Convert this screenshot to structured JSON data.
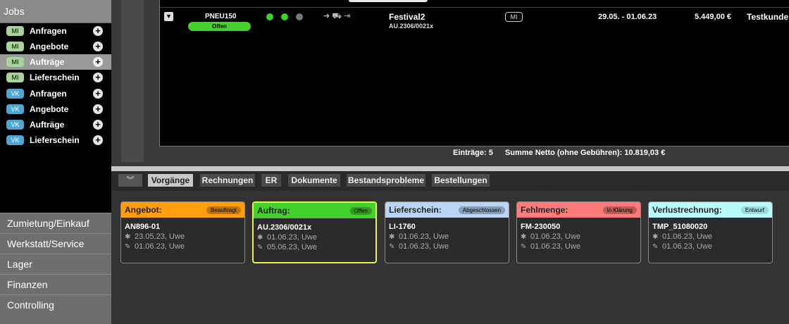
{
  "sidebar": {
    "jobs_title": "Jobs",
    "items": [
      {
        "badge": "MI",
        "label": "Anfragen"
      },
      {
        "badge": "MI",
        "label": "Angebote"
      },
      {
        "badge": "MI",
        "label": "Aufträge"
      },
      {
        "badge": "MI",
        "label": "Lieferschein"
      },
      {
        "badge": "VK",
        "label": "Anfragen"
      },
      {
        "badge": "VK",
        "label": "Angebote"
      },
      {
        "badge": "VK",
        "label": "Aufträge"
      },
      {
        "badge": "VK",
        "label": "Lieferschein"
      }
    ],
    "active_index": 2,
    "sections": [
      "Zumietung/Einkauf",
      "Werkstatt/Service",
      "Lager",
      "Finanzen",
      "Controlling"
    ]
  },
  "list": {
    "row": {
      "code": "PNEU150",
      "status": "Offen",
      "status_color": "#45d12b",
      "dots": [
        "#3fd12b",
        "#3fd12b",
        "#777777"
      ],
      "icons": [
        "arrow-right-icon",
        "truck-icon",
        "sign-in-icon"
      ],
      "title": "Festival2",
      "subtitle": "AU.2306/0021x",
      "badge": "MI",
      "date_range": "29.05. - 01.06.23",
      "amount": "5.449,00 €",
      "customer": "Testkunde"
    },
    "entries_label": "Einträge: 5",
    "sum_label": "Summe Netto (ohne Gebühren): 10.819,03 €"
  },
  "tabs": [
    "Vorgänge",
    "Rechnungen",
    "ER",
    "Dokumente",
    "Bestandsprobleme",
    "Bestellungen"
  ],
  "active_tab": 0,
  "cards": [
    {
      "title": "Angebot:",
      "badge": "Beauftragt",
      "color": "#ff9e0c",
      "code": "AN896-01",
      "created": "23.05.23, Uwe",
      "edited": "01.06.23, Uwe"
    },
    {
      "title": "Auftrag:",
      "badge": "Offen",
      "color": "#45d12b",
      "code": "AU.2306/0021x",
      "created": "01.06.23, Uwe",
      "edited": "05.06.23, Uwe"
    },
    {
      "title": "Lieferschein:",
      "badge": "Abgeschlossen",
      "color": "#b9d4f4",
      "code": "LI-1760",
      "created": "01.06.23, Uwe",
      "edited": "01.06.23, Uwe"
    },
    {
      "title": "Fehlmenge:",
      "badge": "In Klärung",
      "color": "#ff7a7a",
      "code": "FM-230050",
      "created": "01.06.23, Uwe",
      "edited": "01.06.23, Uwe"
    },
    {
      "title": "Verlustrechnung:",
      "badge": "Entwurf",
      "color": "#b9fbfb",
      "code": "TMP_51080020",
      "created": "01.06.23, Uwe",
      "edited": "01.06.23, Uwe"
    }
  ]
}
